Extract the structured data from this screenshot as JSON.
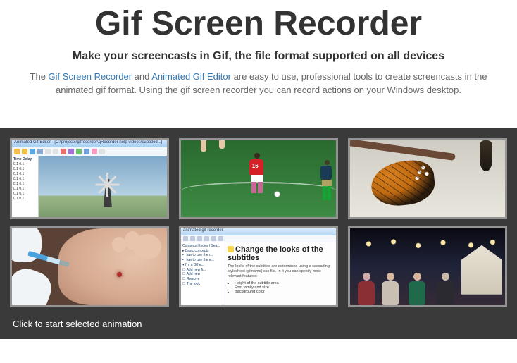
{
  "header": {
    "title": "Gif Screen Recorder",
    "subtitle": "Make your screencasts in Gif, the file format supported on all devices",
    "desc_pre": "The ",
    "link1": "Gif Screen Recorder",
    "desc_mid": " and ",
    "link2": "Animated Gif Editor",
    "desc_post": " are easy to use, professional tools to create screencasts in the animated gif format. Using the gif screen recorder you can record actions on your Windows desktop."
  },
  "thumb1": {
    "titlebar": "Animated Gif Editor - [C:\\projects\\gifrecorder\\gRecorder help videos\\subtitled...]",
    "list_header": "Time   Delay",
    "rows": [
      "0.1   0.1",
      "0.1   0.1",
      "0.1   0.1",
      "0.1   0.1",
      "0.1   0.1",
      "0.1   0.1",
      "0.1   0.1",
      "0.1   0.1"
    ],
    "toolbar_colors": [
      "#f0c040",
      "#f0c040",
      "#5aa9e6",
      "#8ac",
      "#e0e0e0",
      "#e0e0e0",
      "#e97070",
      "#a470d6",
      "#6fc06f",
      "#6fa0e0",
      "#f49ac1",
      "#e0e0e0"
    ]
  },
  "thumb2": {
    "jersey_number": "16"
  },
  "thumb5": {
    "titlebar": "animated gif recorder",
    "tree": [
      "Contents | Index | Sea...",
      "▸ Basic concepts",
      "  • How to use the r...",
      "  • How to use the e...",
      "▾ I'm a Gif e...",
      "  ☐ Add new fi...",
      "  ☐ Add new",
      "  ☐ Remove",
      "  ☐ The look"
    ],
    "heading": "Change the looks of the subtitles",
    "para": "The looks of the subtitles are determined using a cascading stylesheet (gifname).css file. In it you can specify most relevant features:",
    "bullets": [
      "Height of the subtitle area",
      "Font family and size",
      "Background color"
    ]
  },
  "gallery": {
    "caption": "Click to start selected animation"
  }
}
